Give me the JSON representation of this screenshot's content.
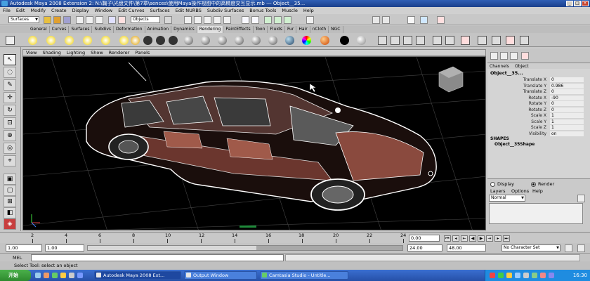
{
  "window": {
    "title": "Autodesk Maya 2008 Extension 2: N:\\鞠子\\光盘文件\\第7章\\sences\\使用Maya操作视图中的高精度交互显示.mb  ---  Object__35...",
    "min": "_",
    "max": "□",
    "close": "×"
  },
  "menubar": [
    "File",
    "Edit",
    "Modify",
    "Create",
    "Display",
    "Window",
    "Edit Curves",
    "Surfaces",
    "Edit NURBS",
    "Subdiv Surfaces",
    "Bonus Tools",
    "Muscle",
    "Help"
  ],
  "statusline": {
    "mode": "Surfaces",
    "selection": "Objects"
  },
  "shelf_tabs": [
    "General",
    "Curves",
    "Surfaces",
    "Subdivs",
    "Deformation",
    "Animation",
    "Dynamics",
    "Rendering",
    "PaintEffects",
    "Toon",
    "Fluids",
    "Fur",
    "Hair",
    "nCloth",
    "NGC"
  ],
  "active_shelf": "Rendering",
  "panel_menu": [
    "View",
    "Shading",
    "Lighting",
    "Show",
    "Renderer",
    "Panels"
  ],
  "channel_box": {
    "tabs": [
      "Channels",
      "Object"
    ],
    "object_name": "Object__35...",
    "attributes": [
      {
        "name": "Translate X",
        "value": "0"
      },
      {
        "name": "Translate Y",
        "value": "0.986"
      },
      {
        "name": "Translate Z",
        "value": "0"
      },
      {
        "name": "Rotate X",
        "value": "-90"
      },
      {
        "name": "Rotate Y",
        "value": "0"
      },
      {
        "name": "Rotate Z",
        "value": "0"
      },
      {
        "name": "Scale X",
        "value": "1"
      },
      {
        "name": "Scale Y",
        "value": "1"
      },
      {
        "name": "Scale Z",
        "value": "1"
      },
      {
        "name": "Visibility",
        "value": "on"
      }
    ],
    "shapes_header": "SHAPES",
    "shape_name": "Object__35Shape"
  },
  "layer_editor": {
    "display_label": "Display",
    "render_label": "Render",
    "menus": [
      "Layers",
      "Options",
      "Help"
    ],
    "layer_mode": "Normal"
  },
  "time_slider": {
    "ticks": [
      "2",
      "4",
      "6",
      "8",
      "10",
      "12",
      "14",
      "16",
      "18",
      "20",
      "22",
      "24"
    ],
    "current_time": "0.00"
  },
  "range_slider": {
    "start": "1.00",
    "range_start": "1.00",
    "range_end": "24.00",
    "end": "48.00",
    "char_set": "No Character Set"
  },
  "command_line": {
    "label": "MEL"
  },
  "help_line": "Select Tool: select an object",
  "taskbar": {
    "start": "开始",
    "items": [
      "Autodesk Maya 2008 Ext...",
      "Output Window",
      "Camtasia Studio - Untitle..."
    ],
    "clock": "16:30"
  },
  "colors": {
    "title_bar": "#1a3f8c",
    "viewport_bg": "#000000",
    "wireframe": "#ffffff",
    "car_shade": "#c87060",
    "taskbar": "#2650a8"
  }
}
